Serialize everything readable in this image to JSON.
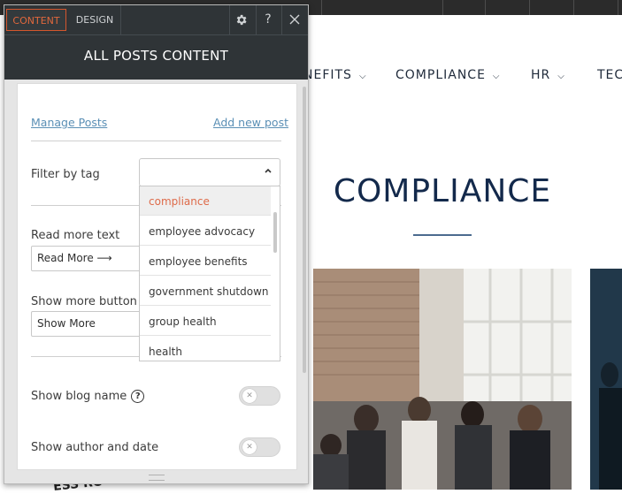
{
  "website": {
    "nav": [
      {
        "label": "NEFITS",
        "has_chevron": true
      },
      {
        "label": "COMPLIANCE",
        "has_chevron": true
      },
      {
        "label": "HR",
        "has_chevron": true
      },
      {
        "label": "TEC",
        "has_chevron": false
      }
    ],
    "heading": "COMPLIANCE",
    "photo_text": "ESS RO"
  },
  "panel": {
    "tabs": [
      {
        "label": "CONTENT",
        "active": true
      },
      {
        "label": "DESIGN",
        "active": false
      }
    ],
    "header_icons": [
      "gear-icon",
      "help-icon",
      "close-icon"
    ],
    "help_glyph": "?",
    "title": "ALL POSTS CONTENT",
    "manage_posts": "Manage Posts",
    "add_new_post": "Add new post",
    "filter_by_tag": {
      "label": "Filter by tag",
      "value": "",
      "options": [
        "compliance",
        "employee advocacy",
        "employee benefits",
        "government shutdown",
        "group health",
        "health"
      ],
      "highlighted": "compliance"
    },
    "read_more_text": {
      "label": "Read more text",
      "value": "Read More ⟶"
    },
    "show_more_button": {
      "label": "Show more button",
      "value": "Show More"
    },
    "show_blog_name": {
      "label": "Show blog name",
      "enabled": false
    },
    "show_author_and_date": {
      "label": "Show author and date",
      "enabled": false
    }
  },
  "colors": {
    "accent": "#e0683d",
    "panel_header": "#2f3437",
    "link": "#5a8fb5",
    "heading": "#13294b"
  }
}
